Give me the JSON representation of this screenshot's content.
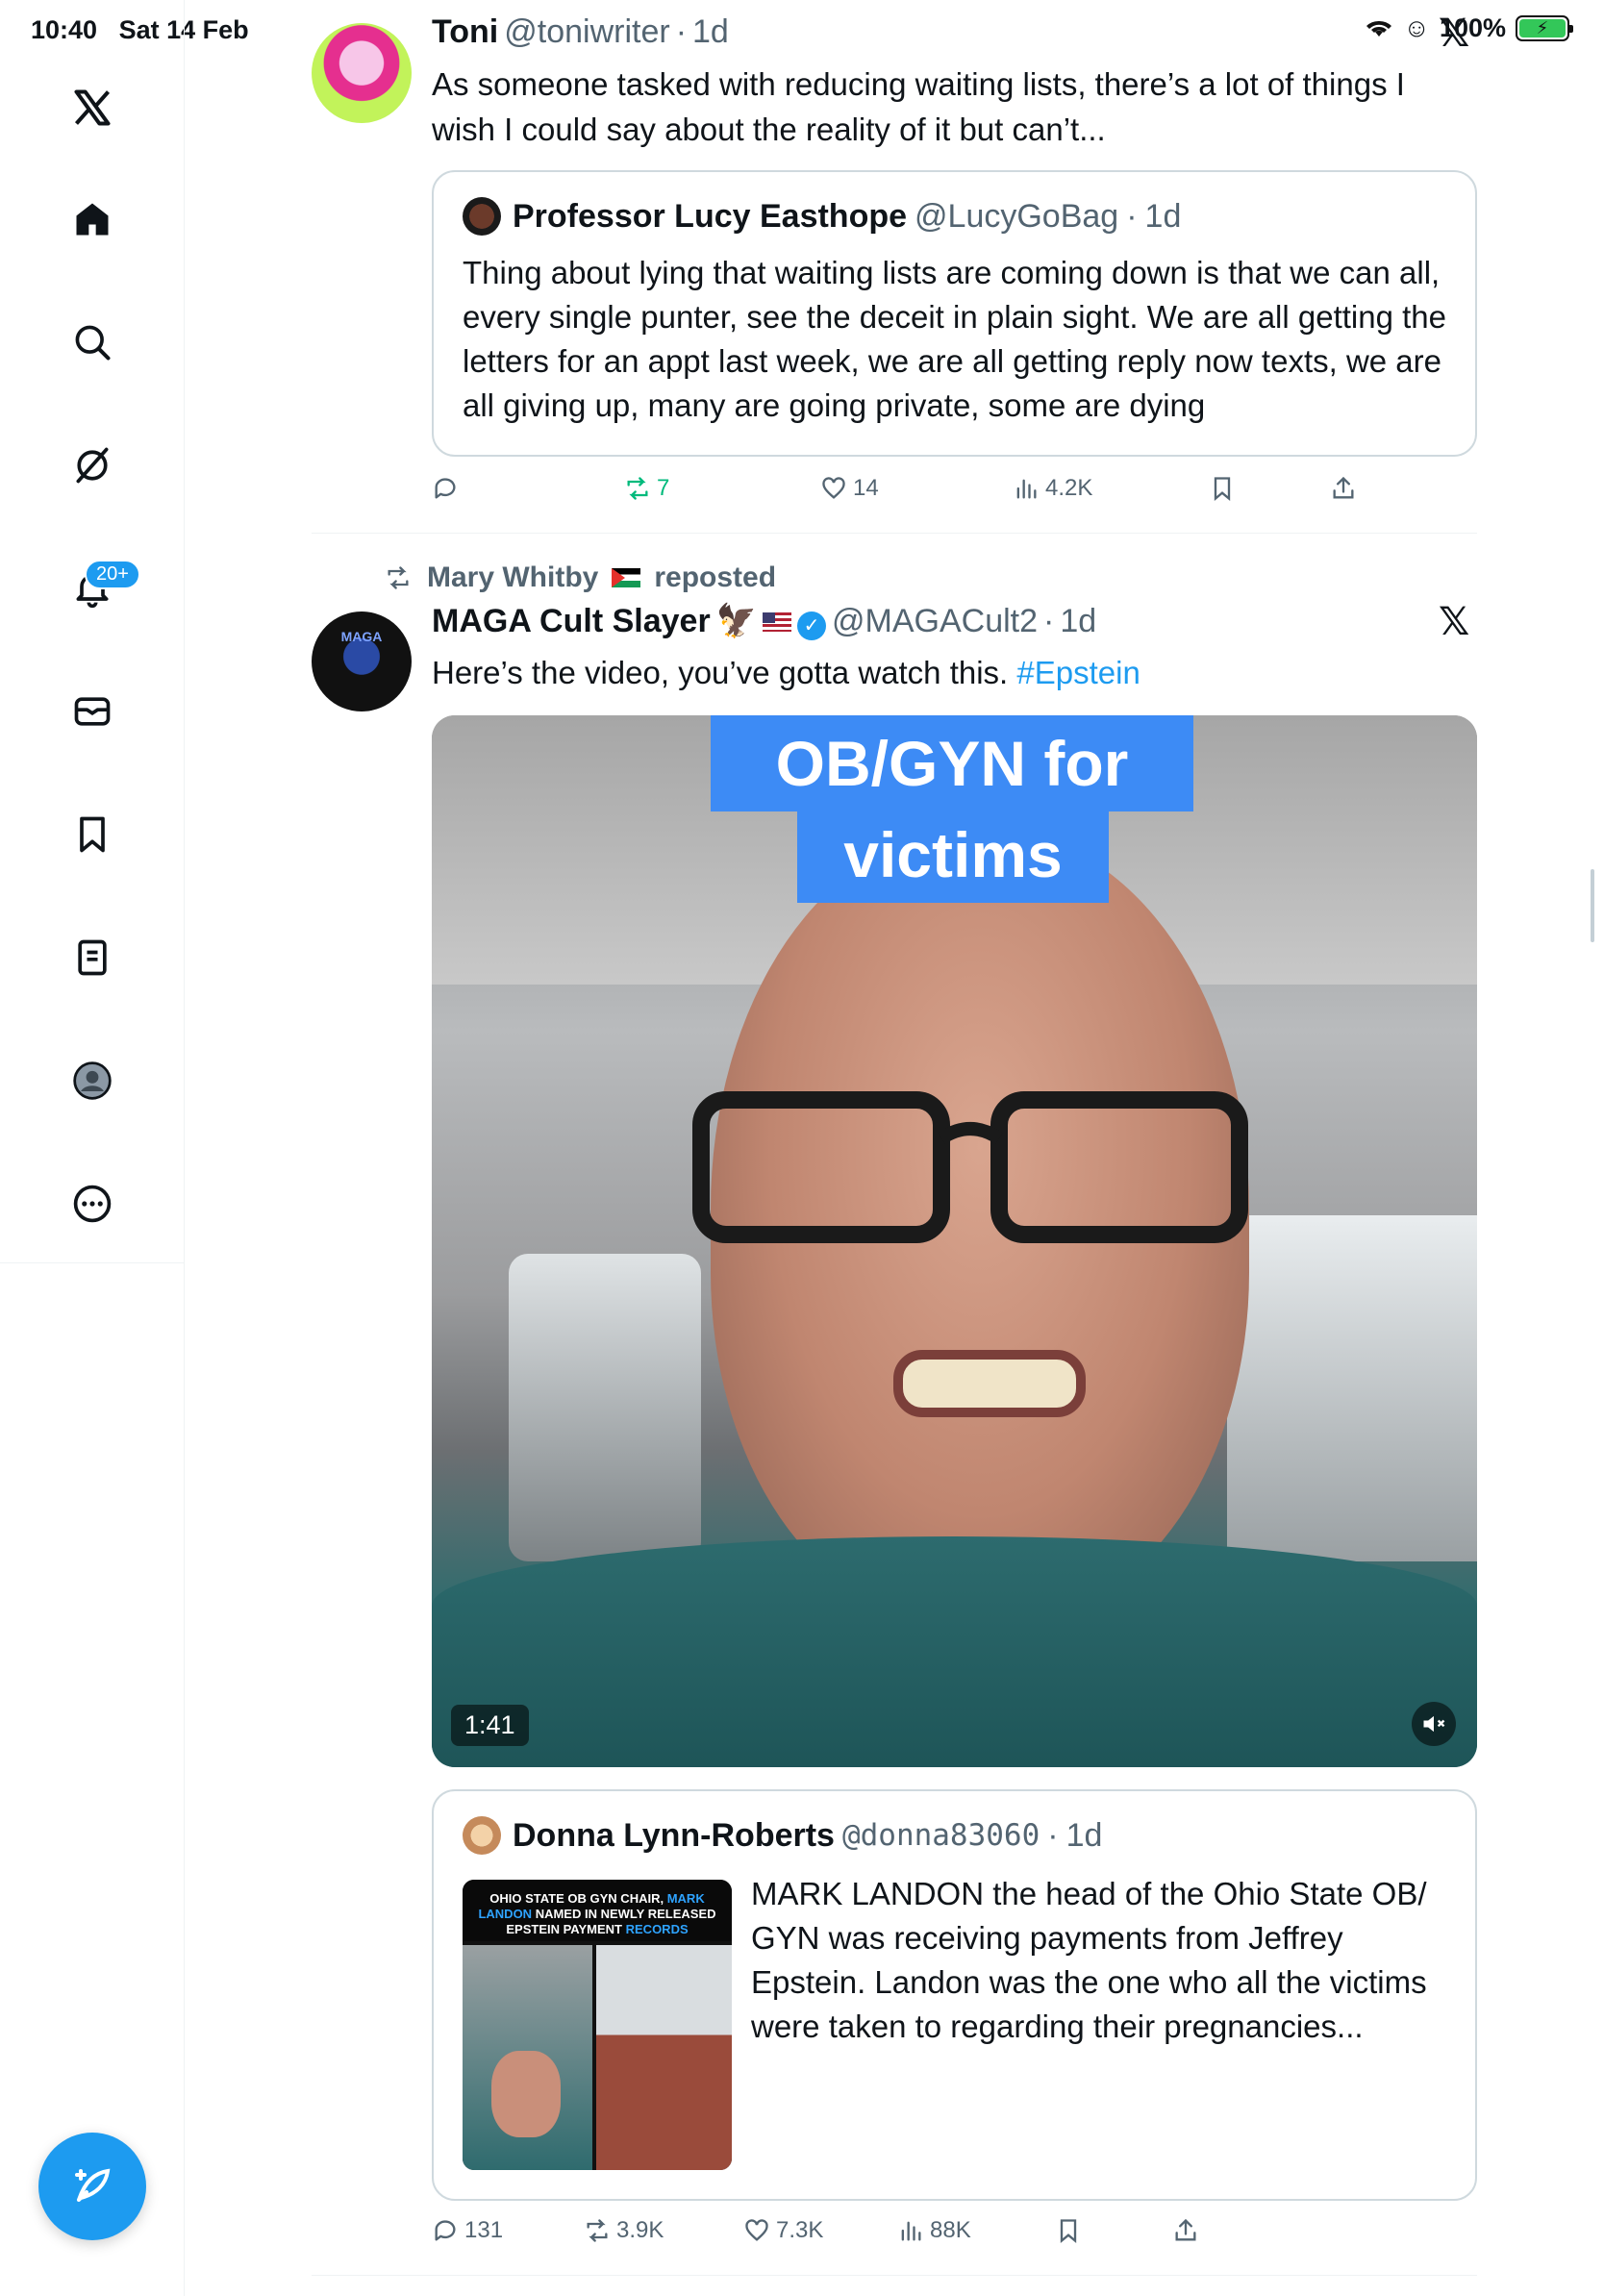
{
  "status_bar": {
    "time": "10:40",
    "date": "Sat 14 Feb",
    "battery": "100%",
    "battery_level": 1.0
  },
  "sidebar": {
    "items": [
      {
        "name": "x-logo-icon"
      },
      {
        "name": "home-icon"
      },
      {
        "name": "search-icon"
      },
      {
        "name": "grok-icon"
      },
      {
        "name": "notifications-icon"
      },
      {
        "name": "messages-icon"
      },
      {
        "name": "bookmarks-icon"
      },
      {
        "name": "lists-icon"
      },
      {
        "name": "profile-icon"
      },
      {
        "name": "more-icon"
      }
    ],
    "notifications_badge": "20+"
  },
  "tweets": [
    {
      "name": "Toni",
      "handle": "@toniwriter",
      "time": "1d",
      "text": "As someone tasked with reducing waiting lists, there’s a lot of things I wish I could say about the reality of it but can’t...",
      "quote": {
        "name": "Professor Lucy Easthope",
        "handle": "@LucyGoBag",
        "time": "1d",
        "text": "Thing about lying that waiting lists are coming down is that we can all, every single punter, see the deceit in plain sight. We are all getting the letters for an appt last week, we are all getting reply now texts, we are all giving up, many are going private, some are dying"
      },
      "actions": {
        "reply": "",
        "repost": "7",
        "like": "14",
        "views": "4.2K"
      }
    },
    {
      "reposted_by": "Mary Whitby",
      "reposted_label": "reposted",
      "name": "MAGA Cult Slayer",
      "handle": "@MAGACult2",
      "time": "1d",
      "avatar_text": "MAGA",
      "text_main": "Here’s the video, you’ve gotta watch this.",
      "hashtag": "#Epstein",
      "video": {
        "caption_line1": "OB/GYN for",
        "caption_line2": "victims",
        "duration": "1:41"
      },
      "quote": {
        "name": "Donna Lynn-Roberts",
        "handle": "@donna83060",
        "time": "1d",
        "thumb_title_1": "OHIO STATE OB GYN CHAIR,",
        "thumb_title_highlight": "MARK LANDON",
        "thumb_title_2": "NAMED IN NEWLY RELEASED EPSTEIN PAYMENT",
        "thumb_title_highlight2": "RECORDS",
        "text": "MARK LANDON the head of the Ohio State OB/ GYN was receiving payments from Jeffrey Epstein. Landon was the one who all the victims were taken to regarding their pregnancies..."
      },
      "actions": {
        "reply": "131",
        "repost": "3.9K",
        "like": "7.3K",
        "views": "88K"
      }
    }
  ],
  "colors": {
    "accent": "#1d9bf0",
    "muted": "#536471",
    "repost_green": "#00ba7c"
  }
}
